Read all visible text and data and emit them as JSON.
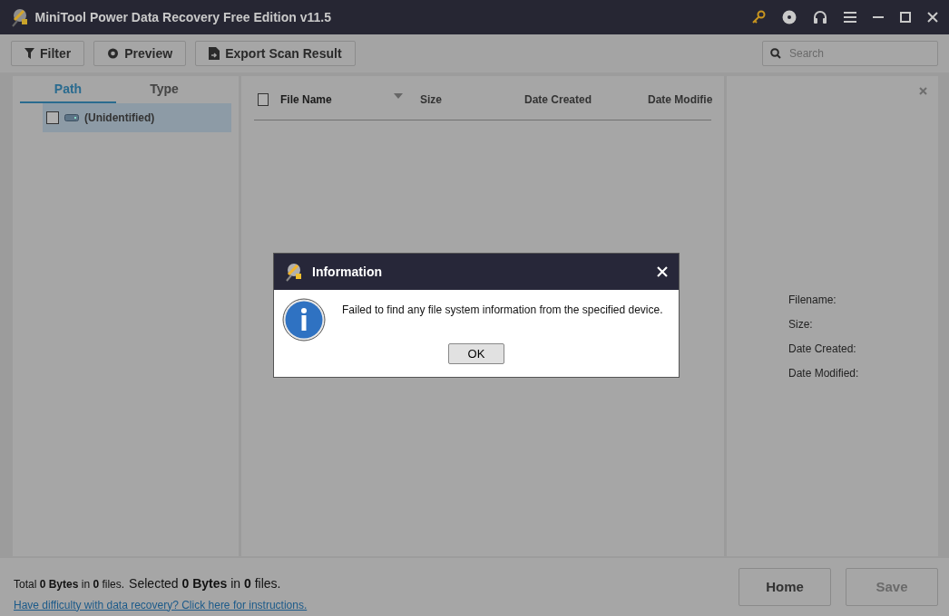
{
  "window": {
    "title": "MiniTool Power Data Recovery Free Edition v11.5"
  },
  "toolbar": {
    "buttons": [
      {
        "label": "Filter",
        "kind": "filter"
      },
      {
        "label": "Preview",
        "kind": "preview"
      },
      {
        "label": "Export Scan Result",
        "kind": "export"
      }
    ],
    "search": {
      "placeholder": "Search"
    }
  },
  "tabs": [
    {
      "label": "Path",
      "selected": true
    },
    {
      "label": "Type",
      "selected": false
    }
  ],
  "tree": [
    {
      "label": "(Unidentified)",
      "selected": true,
      "checked": false
    }
  ],
  "table": {
    "select_all_checked": false,
    "columns": [
      {
        "label": "File Name",
        "sorted": true
      },
      {
        "label": "Size",
        "sorted": false
      },
      {
        "label": "Date Created",
        "sorted": false
      },
      {
        "label": "Date Modifie",
        "sorted": false
      }
    ]
  },
  "details": {
    "labels": [
      "Filename:",
      "Size:",
      "Date Created:",
      "Date Modified:"
    ]
  },
  "status": {
    "total": "Total **0 Bytes** in **0** files.",
    "selected": "Selected **0 Bytes** in **0** files.",
    "help_link": "Have difficulty with data recovery? Click here for instructions."
  },
  "footer_buttons": [
    {
      "label": "Home",
      "disabled": false
    },
    {
      "label": "Save",
      "disabled": true
    }
  ],
  "dialog": {
    "title": "Information",
    "message": "Failed to find any file system information from the specified device.",
    "button": "OK"
  }
}
